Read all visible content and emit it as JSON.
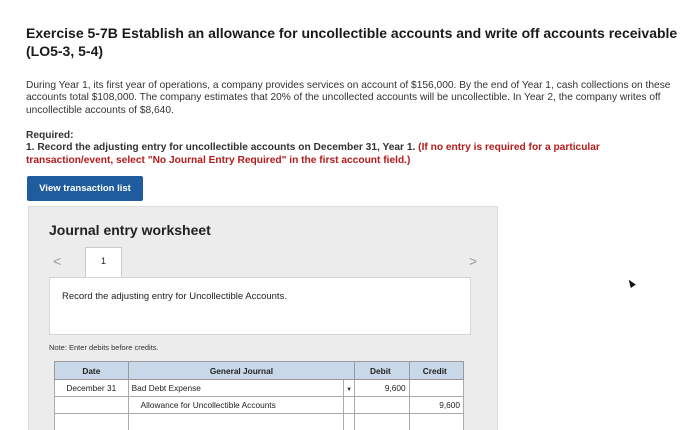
{
  "header": {
    "title": "Exercise 5-7B Establish an allowance for uncollectible accounts and write off accounts receivable (LO5-3, 5-4)"
  },
  "problem": {
    "description": "During Year 1, its first year of operations, a company provides services on account of $156,000. By the end of Year 1, cash collections on these accounts total $108,000. The company estimates that 20% of the uncollected accounts will be uncollectible. In Year 2, the company writes off uncollectible accounts of $8,640.",
    "required_label": "Required:",
    "requirement_prefix": "1. Record the adjusting entry for uncollectible accounts on December 31, Year 1.",
    "requirement_note": "(If no entry is required for a particular transaction/event, select \"No Journal Entry Required\" in the first account field.)"
  },
  "toolbar": {
    "view_transaction_label": "View transaction list"
  },
  "worksheet": {
    "title": "Journal entry worksheet",
    "nav_prev": "<",
    "nav_next": ">",
    "current_tab": "1",
    "entry_instruction": "Record the adjusting entry for Uncollectible Accounts.",
    "note": "Note: Enter debits before credits."
  },
  "journal": {
    "headers": {
      "date": "Date",
      "general_journal": "General Journal",
      "debit": "Debit",
      "credit": "Credit"
    },
    "rows": [
      {
        "date": "December 31",
        "account": "Bad Debt Expense",
        "debit": "9,600",
        "credit": ""
      },
      {
        "date": "",
        "account": "Allowance for Uncollectible Accounts",
        "debit": "",
        "credit": "9,600"
      }
    ]
  }
}
